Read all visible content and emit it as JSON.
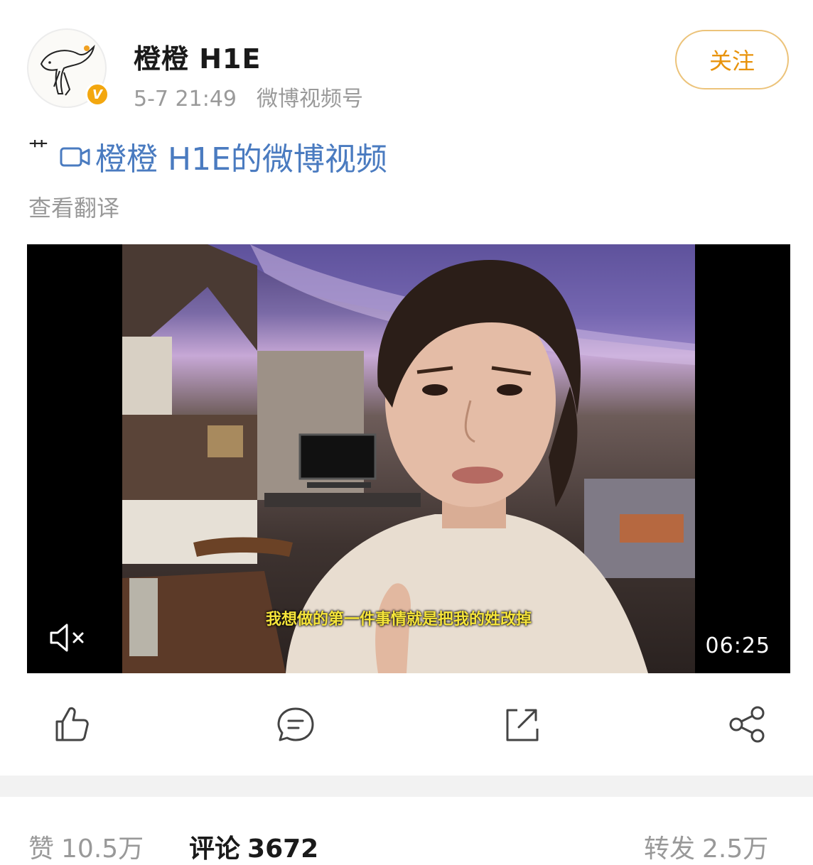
{
  "post": {
    "username": "橙橙 H1E",
    "timestamp": "5-7 21:49",
    "source": "微博视频号",
    "follow_label": "关注",
    "prefix": "艹",
    "video_link_text": "橙橙 H1E的微博视频",
    "translate_label": "查看翻译"
  },
  "video": {
    "subtitle": "我想做的第一件事情就是把我的姓改掉",
    "duration": "06:25",
    "muted": true
  },
  "actions": [
    "like-icon",
    "comment-icon",
    "repost-icon",
    "share-icon"
  ],
  "stats": {
    "likes_label": "赞",
    "likes_value": "10.5万",
    "comments_label": "评论",
    "comments_value": "3672",
    "reposts_label": "转发",
    "reposts_value": "2.5万"
  },
  "colors": {
    "accent": "#e8930b",
    "link": "#4a7bc0",
    "verified": "#f3a70f"
  }
}
